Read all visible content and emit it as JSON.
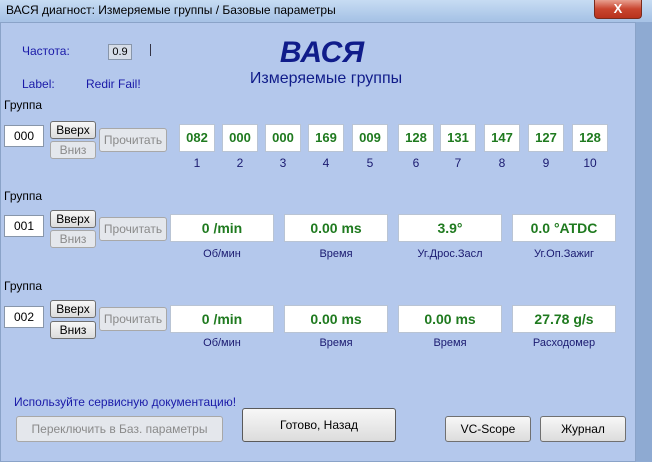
{
  "window": {
    "title": "ВАСЯ диагност: Измеряемые группы / Базовые параметры",
    "close_label": "X"
  },
  "header": {
    "freq_label": "Частота:",
    "freq_value": "0.9",
    "label_label": "Label:",
    "label_value": "Redir Fail!",
    "app_title": "ВАСЯ",
    "app_subtitle": "Измеряемые группы"
  },
  "groups": [
    {
      "label": "Группа",
      "number": "000",
      "up": "Вверх",
      "down": "Вниз",
      "read": "Прочитать",
      "values": [
        "082",
        "000",
        "000",
        "169",
        "009",
        "128",
        "131",
        "147",
        "127",
        "128"
      ],
      "indices": [
        "1",
        "2",
        "3",
        "4",
        "5",
        "6",
        "7",
        "8",
        "9",
        "10"
      ]
    },
    {
      "label": "Группа",
      "number": "001",
      "up": "Вверх",
      "down": "Вниз",
      "read": "Прочитать",
      "fields": [
        {
          "value": "0 /min",
          "label": "Об/мин"
        },
        {
          "value": "0.00 ms",
          "label": "Время"
        },
        {
          "value": "3.9°",
          "label": "Уг.Дрос.Засл"
        },
        {
          "value": "0.0 °ATDC",
          "label": "Уг.Оп.Зажиг"
        }
      ]
    },
    {
      "label": "Группа",
      "number": "002",
      "up": "Вверх",
      "down": "Вниз",
      "read": "Прочитать",
      "fields": [
        {
          "value": "0 /min",
          "label": "Об/мин"
        },
        {
          "value": "0.00 ms",
          "label": "Время"
        },
        {
          "value": "0.00 ms",
          "label": "Время"
        },
        {
          "value": "27.78 g/s",
          "label": "Расходомер"
        }
      ]
    }
  ],
  "footer": {
    "note": "Используйте сервисную документацию!",
    "switch_button": "Переключить в Баз. параметры",
    "done_button": "Готово, Назад",
    "vcscope_button": "VC-Scope",
    "journal_button": "Журнал"
  }
}
